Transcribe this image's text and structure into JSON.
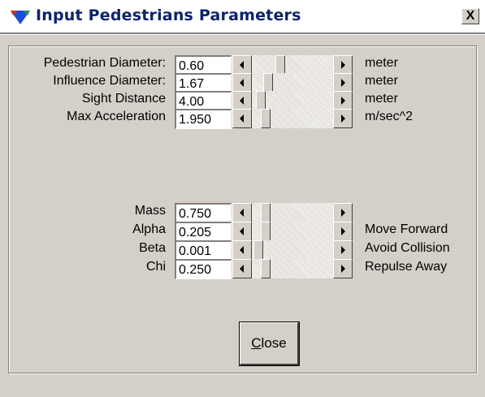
{
  "window": {
    "title": "Input Pedestrians Parameters",
    "close_glyph": "X"
  },
  "params_top": [
    {
      "label": "Pedestrian Diameter:",
      "value": "0.60",
      "unit": "meter",
      "slider_position": 0.33
    },
    {
      "label": "Influence Diameter:",
      "value": "1.67",
      "unit": "meter",
      "slider_position": 0.16
    },
    {
      "label": "Sight Distance",
      "value": "4.00",
      "unit": "meter",
      "slider_position": 0.06
    },
    {
      "label": "Max Acceleration",
      "value": "1.950",
      "unit": "m/sec^2",
      "slider_position": 0.13
    }
  ],
  "params_bottom": [
    {
      "label": "Mass",
      "value": "0.750",
      "unit": "",
      "slider_position": 0.13
    },
    {
      "label": "Alpha",
      "value": "0.205",
      "unit": "Move Forward",
      "slider_position": 0.13
    },
    {
      "label": "Beta",
      "value": "0.001",
      "unit": "Avoid Collision",
      "slider_position": 0.02
    },
    {
      "label": "Chi",
      "value": "0.250",
      "unit": "Repulse Away",
      "slider_position": 0.13
    }
  ],
  "close_button": {
    "mnemonic": "C",
    "rest": "lose"
  },
  "colors": {
    "dialog_bg": "#d4d0c8",
    "title_text": "#0a246a",
    "icon_blue": "#1a4ed8"
  }
}
